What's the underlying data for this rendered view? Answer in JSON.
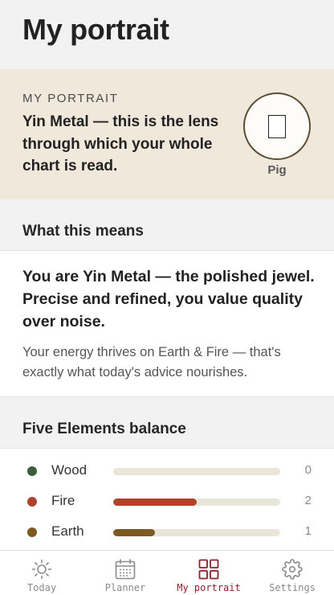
{
  "page": {
    "title": "My portrait"
  },
  "portrait": {
    "eyebrow": "MY PORTRAIT",
    "headline": "Yin Metal — this is the lens through which your whole chart is read.",
    "sign_label": "Pig",
    "sign_glyph": "□"
  },
  "meaning": {
    "section_title": "What this means",
    "headline": "You are Yin Metal — the polished jewel. Precise and refined, you value quality over noise.",
    "body": "Your energy thrives on Earth & Fire — that's exactly what today's advice nourishes."
  },
  "balance": {
    "section_title": "Five Elements balance",
    "max": 4,
    "elements": [
      {
        "name": "Wood",
        "count": 0,
        "color": "#3b5e3a"
      },
      {
        "name": "Fire",
        "count": 2,
        "color": "#b0412b"
      },
      {
        "name": "Earth",
        "count": 1,
        "color": "#7d5a22"
      }
    ]
  },
  "tabs": [
    {
      "label": "Today",
      "icon": "sun-icon",
      "active": false
    },
    {
      "label": "Planner",
      "icon": "calendar-icon",
      "active": false
    },
    {
      "label": "My portrait",
      "icon": "grid-icon",
      "active": true
    },
    {
      "label": "Settings",
      "icon": "gear-icon",
      "active": false
    }
  ],
  "colors": {
    "accent": "#8b2030",
    "card_beige": "#f0e8da",
    "badge_border": "#5b4e35",
    "track": "#ebe4d8"
  }
}
